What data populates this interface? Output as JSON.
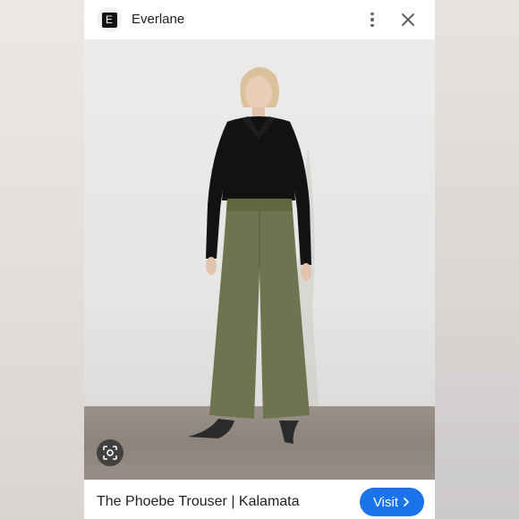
{
  "header": {
    "site_logo_letter": "E",
    "site_name": "Everlane",
    "more_icon": "more-vert-icon",
    "close_icon": "close-icon"
  },
  "image": {
    "subject": "model-wearing-olive-wide-leg-trousers",
    "lens_icon": "lens-search-icon"
  },
  "footer": {
    "product_title": "The Phoebe Trouser | Kalamata",
    "visit_label": "Visit",
    "visit_icon": "chevron-right-icon",
    "accent_color": "#1a73e8"
  }
}
